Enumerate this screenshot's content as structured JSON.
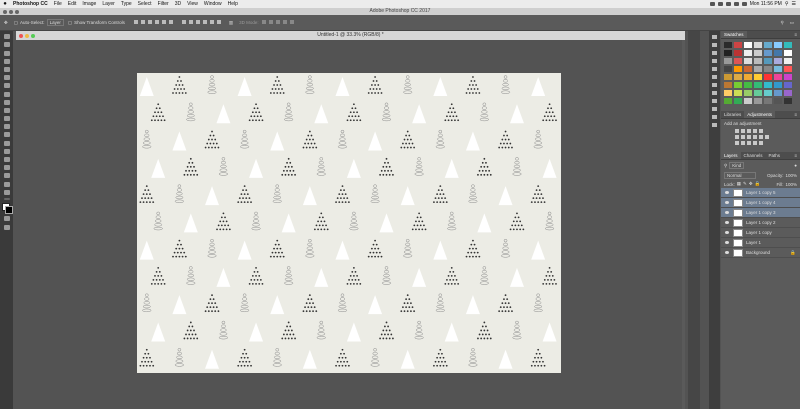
{
  "menubar": {
    "apple": "",
    "app_name": "Photoshop CC",
    "items": [
      "File",
      "Edit",
      "Image",
      "Layer",
      "Type",
      "Select",
      "Filter",
      "3D",
      "View",
      "Window",
      "Help"
    ],
    "clock": "Mon 11:56 PM"
  },
  "window": {
    "title": "Adobe Photoshop CC 2017"
  },
  "options_bar": {
    "auto_select_label": "Auto-Select:",
    "auto_select_value": "Layer",
    "show_transform_label": "Show Transform Controls",
    "mode_3d_label": "3D Mode:"
  },
  "document": {
    "tab_title": "Untitled-1 @ 33.3% (RGB/8) *"
  },
  "swatches_panel": {
    "tab": "Swatches",
    "colors": [
      "#2b2b2b",
      "#c44",
      "#fff",
      "#d8d8d8",
      "#6ac",
      "#8cf",
      "#3bb",
      "#222",
      "#b33",
      "#eee",
      "#ccc",
      "#69c",
      "#47a",
      "#fff",
      "#999",
      "#d55",
      "#ddd",
      "#bbb",
      "#59b",
      "#aad",
      "#eee",
      "#444",
      "#f90",
      "#c63",
      "#aaa",
      "#888",
      "#7bd",
      "#f55",
      "#c93",
      "#da4",
      "#ea3",
      "#fc3",
      "#f33",
      "#e49",
      "#c4c",
      "#b73",
      "#7c3",
      "#4b4",
      "#3b7",
      "#3bc",
      "#39c",
      "#66c",
      "#fc6",
      "#cd5",
      "#9c6",
      "#6c9",
      "#6cc",
      "#69c",
      "#96c",
      "#5a3",
      "#3a5",
      "#ccc",
      "#999",
      "#777",
      "#555",
      "#333"
    ]
  },
  "adjustments_panel": {
    "tabs": [
      "Libraries",
      "Adjustments"
    ],
    "active_tab": "Adjustments",
    "hint": "Add an adjustment"
  },
  "layers_panel": {
    "tabs": [
      "Layers",
      "Channels",
      "Paths"
    ],
    "active_tab": "Layers",
    "filter_kind": "Kind",
    "blend_mode": "Normal",
    "opacity_label": "Opacity:",
    "opacity_value": "100%",
    "lock_label": "Lock:",
    "fill_label": "Fill:",
    "fill_value": "100%",
    "layers": [
      {
        "name": "Layer 1 copy 5",
        "selected": true
      },
      {
        "name": "Layer 1 copy 4",
        "selected": true
      },
      {
        "name": "Layer 1 copy 3",
        "selected": true
      },
      {
        "name": "Layer 1 copy 2",
        "selected": false
      },
      {
        "name": "Layer 1 copy",
        "selected": false
      },
      {
        "name": "Layer 1",
        "selected": false
      },
      {
        "name": "Background",
        "selected": false
      }
    ]
  }
}
